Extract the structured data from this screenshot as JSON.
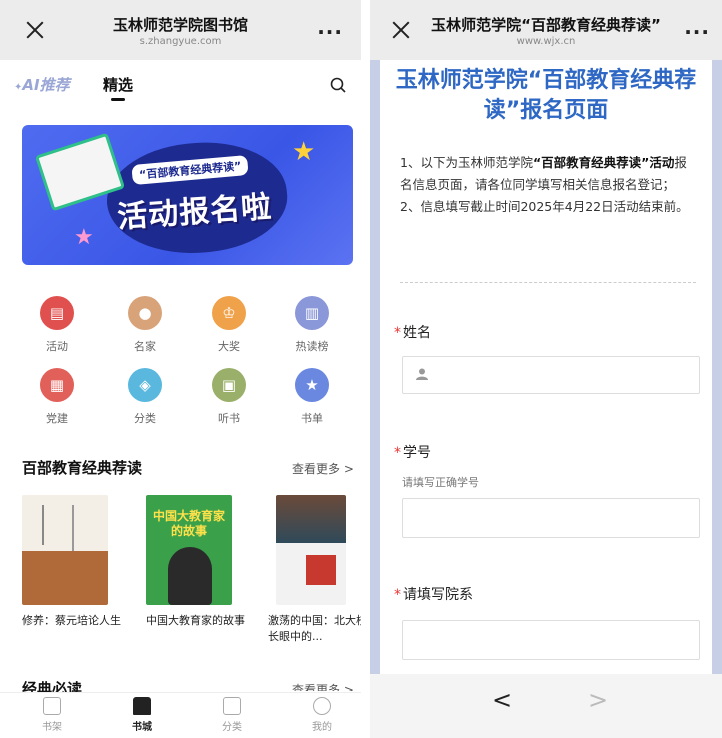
{
  "left": {
    "topbar": {
      "title": "玉林师范学院图书馆",
      "url": "s.zhangyue.com",
      "more": "..."
    },
    "tabs": {
      "ai_label": "AI推荐",
      "selected_tab": "精选"
    },
    "banner": {
      "subtitle": "“百部教育经典荐读”",
      "headline": "活动报名啦"
    },
    "icons": [
      {
        "label": "活动",
        "color": "#e0504e",
        "glyph": "▤"
      },
      {
        "label": "名家",
        "color": "#d9a37a",
        "glyph": "●"
      },
      {
        "label": "大奖",
        "color": "#f0a24a",
        "glyph": "♔"
      },
      {
        "label": "热读榜",
        "color": "#8a97d8",
        "glyph": "▥"
      },
      {
        "label": "党建",
        "color": "#e2605a",
        "glyph": "▦"
      },
      {
        "label": "分类",
        "color": "#5ab8de",
        "glyph": "◈"
      },
      {
        "label": "听书",
        "color": "#9ab06a",
        "glyph": "▣"
      },
      {
        "label": "书单",
        "color": "#6a88e0",
        "glyph": "★"
      }
    ],
    "section": {
      "title": "百部教育经典荐读",
      "more": "查看更多 >"
    },
    "books": [
      {
        "title": "修养：蔡元培论人生"
      },
      {
        "title": "中国大教育家的故事",
        "cover_text": "中国大教育家的故事"
      },
      {
        "title": "激荡的中国：北大校长眼中的..."
      }
    ],
    "section2": {
      "title": "经典必读",
      "more": "查看更多 >"
    },
    "bottom_nav": [
      {
        "label": "书架"
      },
      {
        "label": "书城"
      },
      {
        "label": "分类"
      },
      {
        "label": "我的"
      }
    ]
  },
  "right": {
    "topbar": {
      "title": "玉林师范学院“百部教育经典荐读”",
      "url": "www.wjx.cn",
      "more": "..."
    },
    "heading": "玉林师范学院“百部教育经典荐读”报名页面",
    "intro_1_pre": "1、以下为玉林师范学院",
    "intro_1_bold": "“百部教育经典荐读”活动",
    "intro_1_post": "报名信息页面，请各位同学填写相关信息报名登记；",
    "intro_2": "2、信息填写截止时间2025年4月22日活动结束前。",
    "fields": [
      {
        "label": "姓名",
        "required_mark": "*",
        "hint": ""
      },
      {
        "label": "学号",
        "required_mark": "*",
        "hint": "请填写正确学号"
      },
      {
        "label": "请填写院系",
        "required_mark": "*",
        "hint": ""
      }
    ],
    "nav": {
      "back": "<",
      "forward": ">"
    }
  }
}
